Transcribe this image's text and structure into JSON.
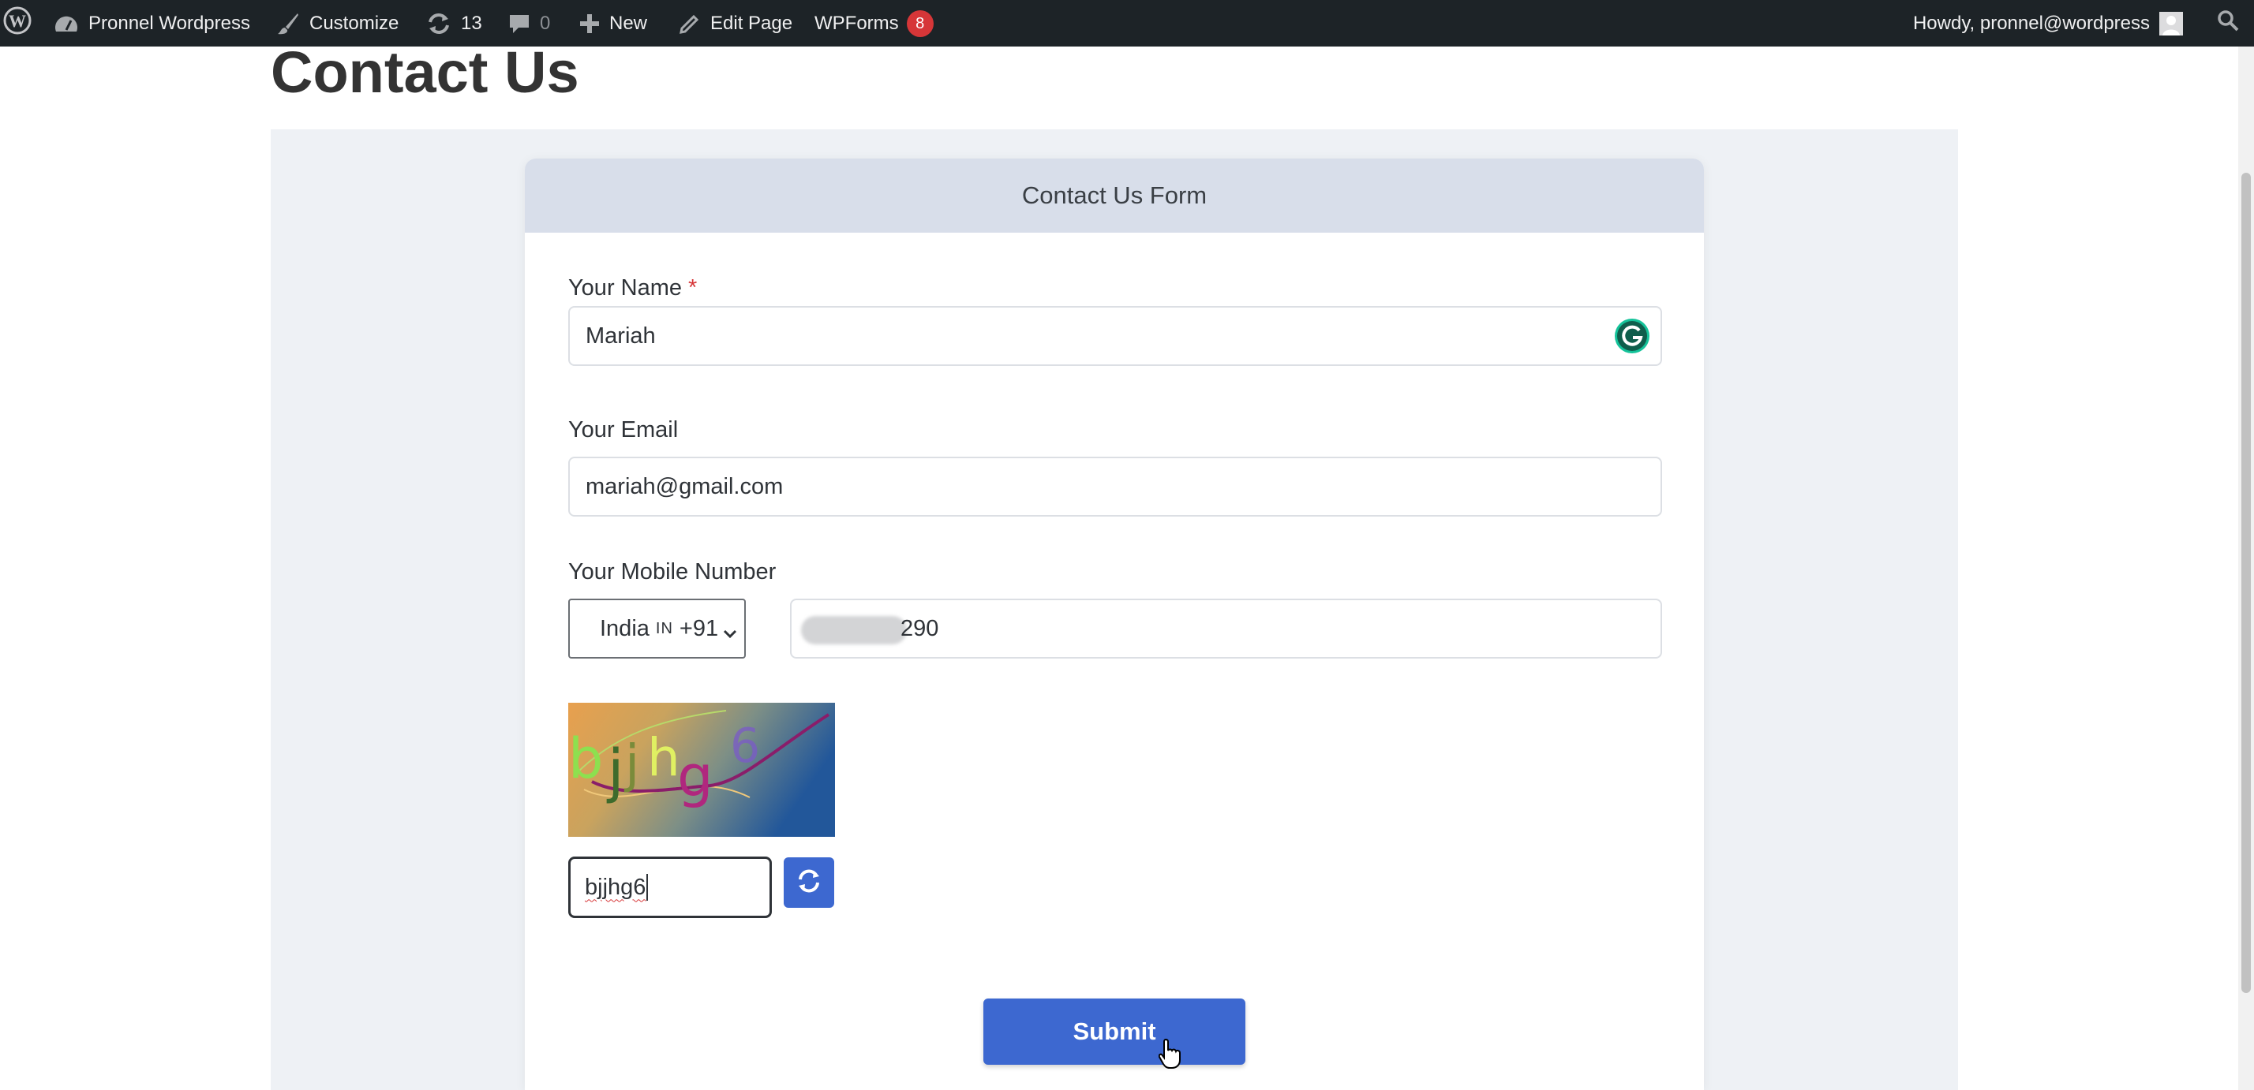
{
  "adminbar": {
    "site_name": "Pronnel Wordpress",
    "customize_label": "Customize",
    "updates_count": "13",
    "comments_count": "0",
    "new_label": "New",
    "edit_page_label": "Edit Page",
    "wpforms_label": "WPForms",
    "wpforms_badge": "8",
    "howdy_text": "Howdy, pronnel@wordpress"
  },
  "page": {
    "title": "Contact Us"
  },
  "form": {
    "header": "Contact Us Form",
    "name_label": "Your Name",
    "required_mark": "*",
    "name_value": "Mariah",
    "email_label": "Your Email",
    "email_value": "mariah@gmail.com",
    "mobile_label": "Your Mobile Number",
    "country_name": "India",
    "country_code": "IN",
    "dial_code": "+91",
    "mobile_value_visible": "290",
    "captcha_input_value": "bjjhg6",
    "submit_label": "Submit"
  },
  "colors": {
    "admin_bar": "#1d2327",
    "accent_blue": "#3d68d0",
    "required_red": "#d63638",
    "content_bg": "#eef1f5",
    "form_header_bg": "#d8deea"
  },
  "icons": {
    "wordpress": "wordpress-logo-icon",
    "site": "dashboard-icon",
    "customize": "brush-icon",
    "updates": "refresh-icon",
    "comments": "comment-icon",
    "new": "plus-icon",
    "edit": "pencil-icon",
    "search": "search-icon",
    "grammarly": "grammarly-icon",
    "refresh_captcha": "refresh-icon"
  }
}
